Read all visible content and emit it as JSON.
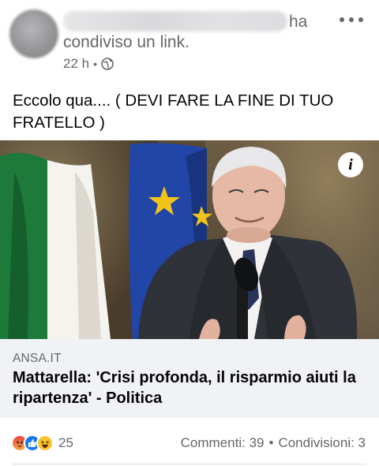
{
  "post": {
    "author_suffix": "ha",
    "shared_text": "condiviso un link.",
    "time": "22 h",
    "separator": "•",
    "audience_icon": "globe-icon",
    "more_icon": "more-options-icon",
    "text_line1": "Eccolo qua.... ( DEVI FARE LA FINE DI TUO",
    "text_line2": "FRATELLO )"
  },
  "link": {
    "domain": "ANSA.IT",
    "title": "Mattarella: 'Crisi profonda, il risparmio aiuti la ripartenza' - Politica",
    "info_icon": "info-icon",
    "info_label": "i"
  },
  "footer": {
    "reaction_icons": [
      "angry-icon",
      "like-icon",
      "haha-icon"
    ],
    "reaction_count": "25",
    "comments": "Commenti: 39",
    "separator": "•",
    "shares": "Condivisioni: 3"
  },
  "colors": {
    "secondary_text": "#65676b",
    "link_card_bg": "#f0f2f5",
    "like_blue": "#1877f2"
  }
}
